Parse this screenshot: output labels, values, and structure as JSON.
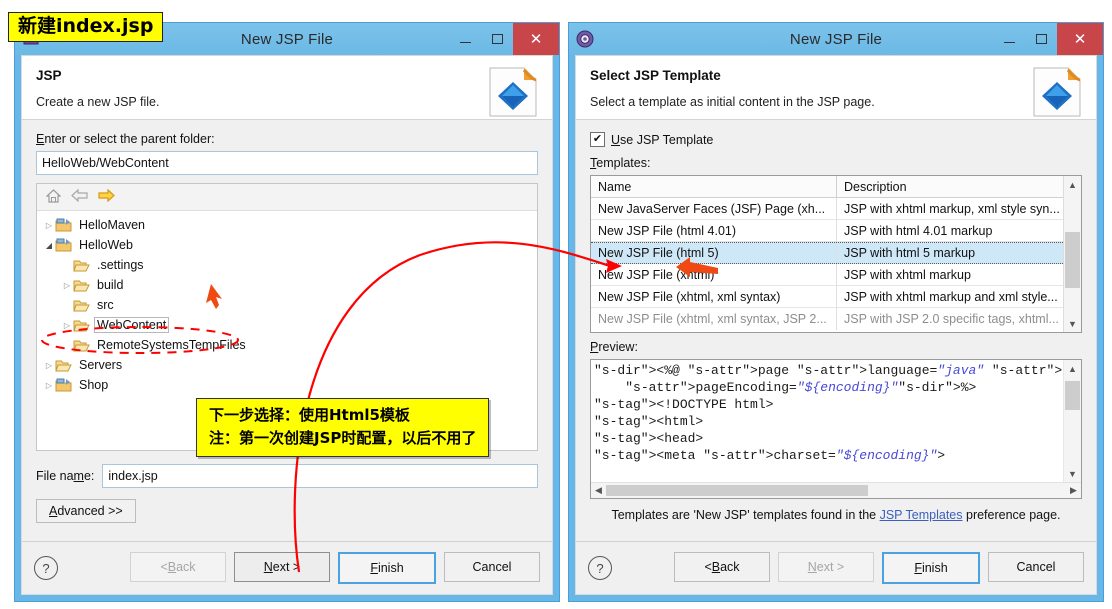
{
  "annotations": {
    "title_label": "新建index.jsp",
    "note_line1": "下一步选择：使用Html5模板",
    "note_line2": "注：第一次创建JSP时配置，以后不用了",
    "accent_color": "#ff0000",
    "highlight_color": "#ffff00"
  },
  "left_dialog": {
    "window_title": "New JSP File",
    "header": {
      "title": "JSP",
      "subtitle": "Create a new JSP file."
    },
    "parent_folder_label": "Enter or select the parent folder:",
    "parent_folder_value": "HelloWeb/WebContent",
    "tree_toolbar": [
      "home-icon",
      "back-arrow-icon",
      "forward-arrow-icon"
    ],
    "tree": [
      {
        "label": "HelloMaven",
        "indent": 0,
        "twisty": "collapsed",
        "icon": "project-folder",
        "selected": false
      },
      {
        "label": "HelloWeb",
        "indent": 0,
        "twisty": "expanded",
        "icon": "project-folder",
        "selected": false
      },
      {
        "label": ".settings",
        "indent": 1,
        "twisty": "none",
        "icon": "folder",
        "selected": false
      },
      {
        "label": "build",
        "indent": 1,
        "twisty": "collapsed",
        "icon": "folder",
        "selected": false
      },
      {
        "label": "src",
        "indent": 1,
        "twisty": "none",
        "icon": "folder",
        "selected": false
      },
      {
        "label": "WebContent",
        "indent": 1,
        "twisty": "collapsed",
        "icon": "folder",
        "selected": true
      },
      {
        "label": "RemoteSystemsTempFiles",
        "indent": 1,
        "twisty": "none",
        "icon": "folder",
        "selected": false
      },
      {
        "label": "Servers",
        "indent": 0,
        "twisty": "collapsed",
        "icon": "folder",
        "selected": false
      },
      {
        "label": "Shop",
        "indent": 0,
        "twisty": "collapsed",
        "icon": "project-folder",
        "selected": false
      }
    ],
    "file_name_label": "File name:",
    "file_name_value": "index.jsp",
    "advanced_label": "Advanced >>",
    "buttons": {
      "help": "?",
      "back": "< Back",
      "next": "Next >",
      "finish": "Finish",
      "cancel": "Cancel"
    }
  },
  "right_dialog": {
    "window_title": "New JSP File",
    "header": {
      "title": "Select JSP Template",
      "subtitle": "Select a template as initial content in the JSP page."
    },
    "use_template_label": "Use JSP Template",
    "use_template_checked": true,
    "templates_label": "Templates:",
    "table": {
      "columns": [
        "Name",
        "Description"
      ],
      "rows": [
        {
          "name": "New JavaServer Faces (JSF) Page (xh...",
          "desc": "JSP with xhtml markup, xml style syn...",
          "selected": false
        },
        {
          "name": "New JSP File (html 4.01)",
          "desc": "JSP with html 4.01 markup",
          "selected": false
        },
        {
          "name": "New JSP File (html 5)",
          "desc": "JSP with html 5 markup",
          "selected": true
        },
        {
          "name": "New JSP File (xhtml)",
          "desc": "JSP with xhtml markup",
          "selected": false
        },
        {
          "name": "New JSP File (xhtml, xml syntax)",
          "desc": "JSP with xhtml markup and xml style...",
          "selected": false
        },
        {
          "name": "New JSP File (xhtml, xml syntax, JSP 2...",
          "desc": "JSP with JSP 2.0 specific tags, xhtml...",
          "selected": false
        }
      ]
    },
    "preview_label": "Preview:",
    "preview_code_lines": [
      "<%@ page language=\"java\" contentType=\"text,",
      "    pageEncoding=\"${encoding}\"%>",
      "<!DOCTYPE html>",
      "<html>",
      "<head>",
      "<meta charset=\"${encoding}\">"
    ],
    "footnote_before": "Templates are 'New JSP' templates found in the ",
    "footnote_link": "JSP Templates",
    "footnote_after": " preference page.",
    "buttons": {
      "help": "?",
      "back": "< Back",
      "next": "Next >",
      "finish": "Finish",
      "cancel": "Cancel"
    }
  }
}
